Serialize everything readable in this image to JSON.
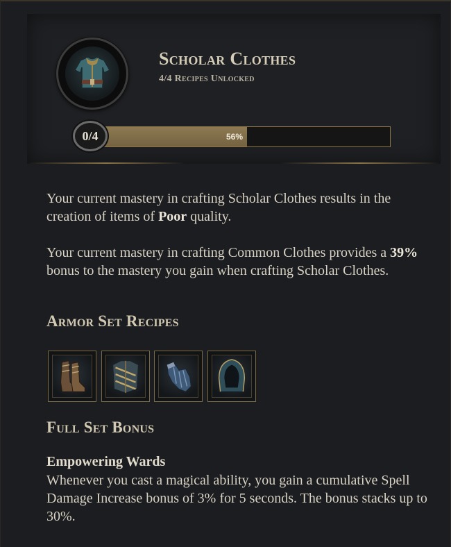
{
  "item": {
    "name": "Scholar Clothes",
    "recipes_unlocked": "4/4 Recipes Unlocked",
    "icon": "cloth-shirt-icon"
  },
  "mastery": {
    "level_badge": "0/4",
    "progress_label": "56%",
    "progress_fraction": 0.52
  },
  "description": {
    "quality_line_pre": "Your current mastery in crafting Scholar Clothes results in the creation of items of ",
    "quality_value": "Poor",
    "quality_line_post": " quality.",
    "bonus_line_pre": "Your current mastery in crafting Common Clothes provides a ",
    "bonus_value": "39%",
    "bonus_line_post": " bonus to the mastery you gain when crafting Scholar Clothes."
  },
  "armor_set": {
    "title": "Armor Set Recipes",
    "recipes": [
      {
        "icon": "boots-icon"
      },
      {
        "icon": "chest-armor-icon"
      },
      {
        "icon": "gloves-icon"
      },
      {
        "icon": "hood-icon"
      }
    ]
  },
  "set_bonus": {
    "title": "Full Set Bonus",
    "name": "Empowering Wards",
    "description": "Whenever you cast a magical ability, you gain a cumulative Spell Damage Increase bonus of 3% for 5 seconds. The bonus stacks up to 30%."
  },
  "colors": {
    "accent_gold": "#8c7646",
    "progress_fill": "#8d7a52",
    "background": "#1c1d20"
  }
}
